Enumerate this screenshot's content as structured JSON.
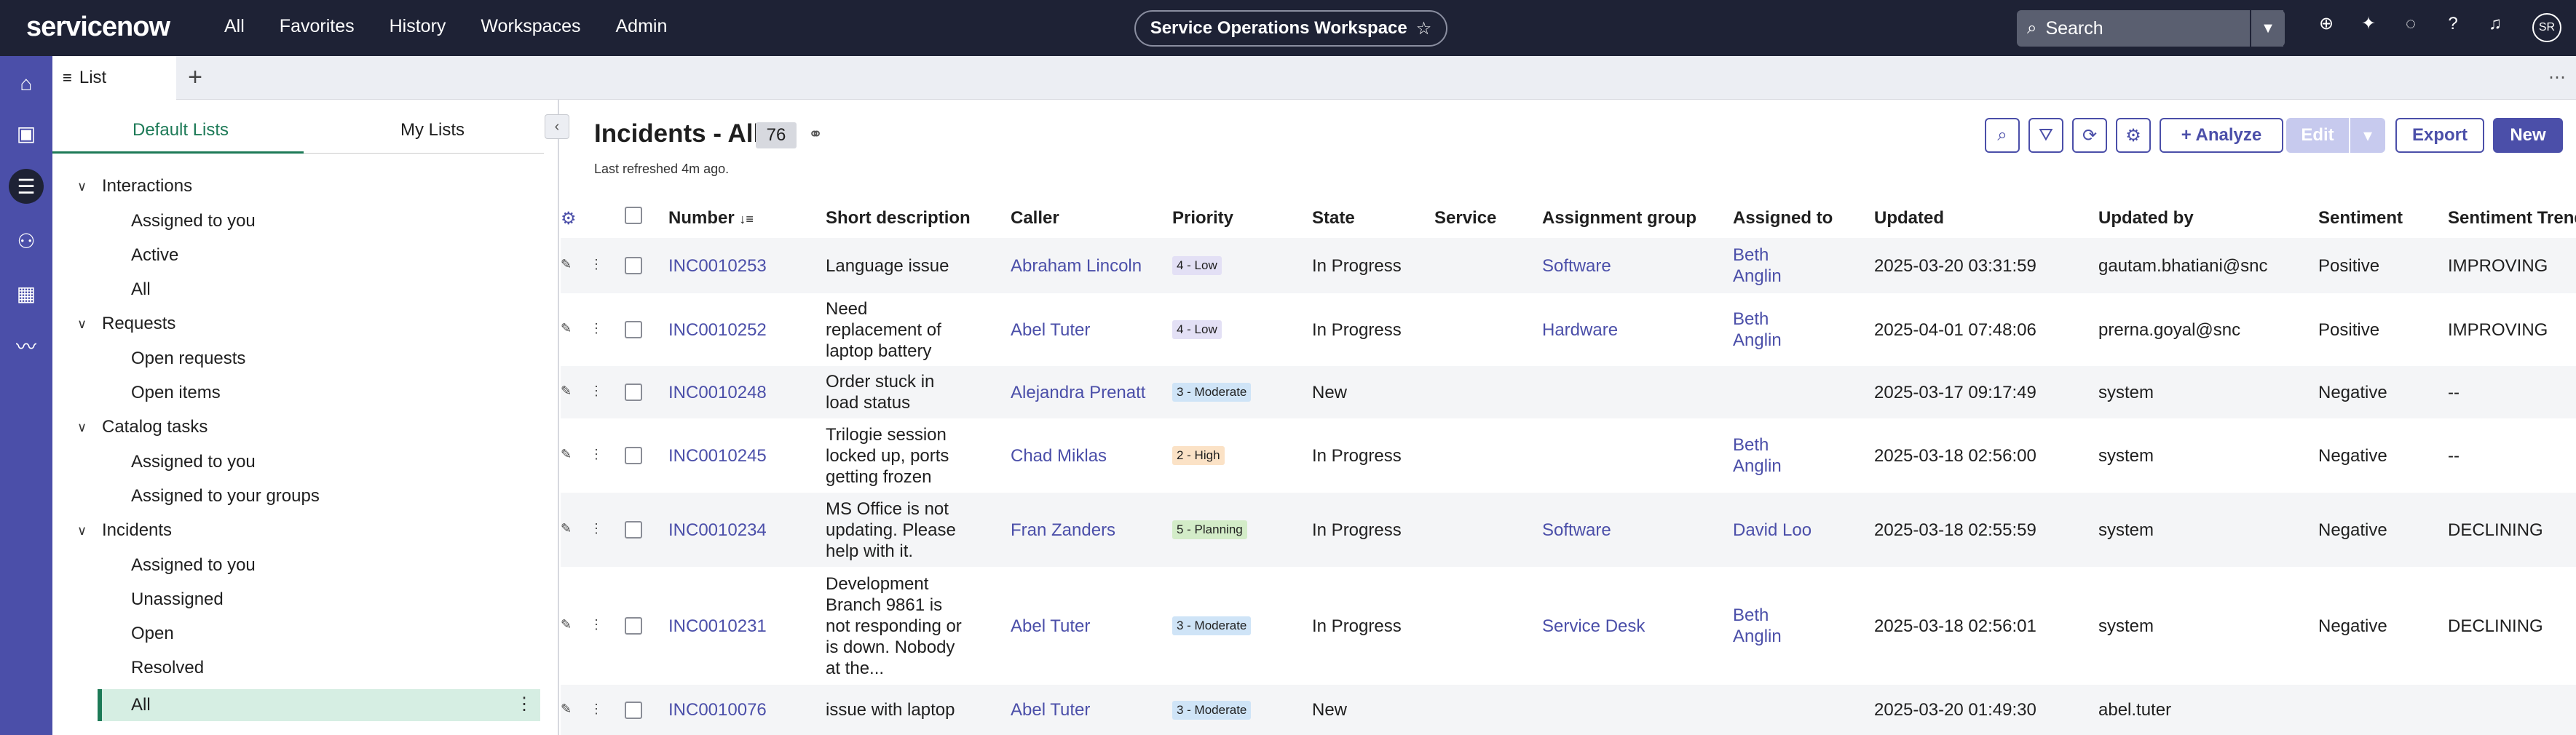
{
  "header": {
    "logo": "servicenow",
    "nav": [
      "All",
      "Favorites",
      "History",
      "Workspaces",
      "Admin"
    ],
    "workspace": "Service Operations Workspace",
    "search_placeholder": "Search",
    "avatar": "SR",
    "icons": [
      "globe-icon",
      "sparkle-icon",
      "chat-icon",
      "help-icon",
      "bell-icon"
    ]
  },
  "rail": [
    "home-icon",
    "inbox-icon",
    "list-icon",
    "people-icon",
    "calendar-icon",
    "activity-icon"
  ],
  "tabs": {
    "active": "List"
  },
  "panel": {
    "seg_default": "Default Lists",
    "seg_mine": "My Lists",
    "groups": [
      {
        "label": "Interactions",
        "items": [
          "Assigned to you",
          "Active",
          "All"
        ]
      },
      {
        "label": "Requests",
        "items": [
          "Open requests",
          "Open items"
        ]
      },
      {
        "label": "Catalog tasks",
        "items": [
          "Assigned to you",
          "Assigned to your groups"
        ]
      },
      {
        "label": "Incidents",
        "items": [
          "Assigned to you",
          "Unassigned",
          "Open",
          "Resolved",
          "All"
        ]
      }
    ]
  },
  "list": {
    "title": "Incidents - All",
    "count": "76",
    "refreshed": "Last refreshed 4m ago.",
    "buttons": {
      "analyze": "+ Analyze",
      "edit": "Edit",
      "export": "Export",
      "new": "New"
    },
    "columns": [
      "Number",
      "Short description",
      "Caller",
      "Priority",
      "State",
      "Service",
      "Assignment group",
      "Assigned to",
      "Updated",
      "Updated by",
      "Sentiment",
      "Sentiment Trend"
    ],
    "rows": [
      {
        "number": "INC0010253",
        "desc": "Language issue",
        "caller": "Abraham Lincoln",
        "priority": "4 - Low",
        "state": "In Progress",
        "service": "",
        "group": "Software",
        "assigned": "Beth Anglin",
        "updated": "2025-03-20 03:31:59",
        "updated_by": "gautam.bhatiani@snc",
        "sentiment": "Positive",
        "trend": "IMPROVING"
      },
      {
        "number": "INC0010252",
        "desc": "Need replacement of laptop battery",
        "caller": "Abel Tuter",
        "priority": "4 - Low",
        "state": "In Progress",
        "service": "",
        "group": "Hardware",
        "assigned": "Beth Anglin",
        "updated": "2025-04-01 07:48:06",
        "updated_by": "prerna.goyal@snc",
        "sentiment": "Positive",
        "trend": "IMPROVING"
      },
      {
        "number": "INC0010248",
        "desc": "Order stuck in load status",
        "caller": "Alejandra Prenatt",
        "priority": "3 - Moderate",
        "state": "New",
        "service": "",
        "group": "",
        "assigned": "",
        "updated": "2025-03-17 09:17:49",
        "updated_by": "system",
        "sentiment": "Negative",
        "trend": "--"
      },
      {
        "number": "INC0010245",
        "desc": "Trilogie session locked up, ports getting frozen",
        "caller": "Chad Miklas",
        "priority": "2 - High",
        "state": "In Progress",
        "service": "",
        "group": "",
        "assigned": "Beth Anglin",
        "updated": "2025-03-18 02:56:00",
        "updated_by": "system",
        "sentiment": "Negative",
        "trend": "--"
      },
      {
        "number": "INC0010234",
        "desc": "MS Office is not updating. Please help with it.",
        "caller": "Fran Zanders",
        "priority": "5 - Planning",
        "state": "In Progress",
        "service": "",
        "group": "Software",
        "assigned": "David Loo",
        "updated": "2025-03-18 02:55:59",
        "updated_by": "system",
        "sentiment": "Negative",
        "trend": "DECLINING"
      },
      {
        "number": "INC0010231",
        "desc": "Development Branch 9861 is not responding or is down. Nobody at the...",
        "caller": "Abel Tuter",
        "priority": "3 - Moderate",
        "state": "In Progress",
        "service": "",
        "group": "Service Desk",
        "assigned": "Beth Anglin",
        "updated": "2025-03-18 02:56:01",
        "updated_by": "system",
        "sentiment": "Negative",
        "trend": "DECLINING"
      },
      {
        "number": "INC0010076",
        "desc": "issue with laptop",
        "caller": "Abel Tuter",
        "priority": "3 - Moderate",
        "state": "New",
        "service": "",
        "group": "",
        "assigned": "",
        "updated": "2025-03-20 01:49:30",
        "updated_by": "abel.tuter",
        "sentiment": "",
        "trend": ""
      }
    ]
  }
}
